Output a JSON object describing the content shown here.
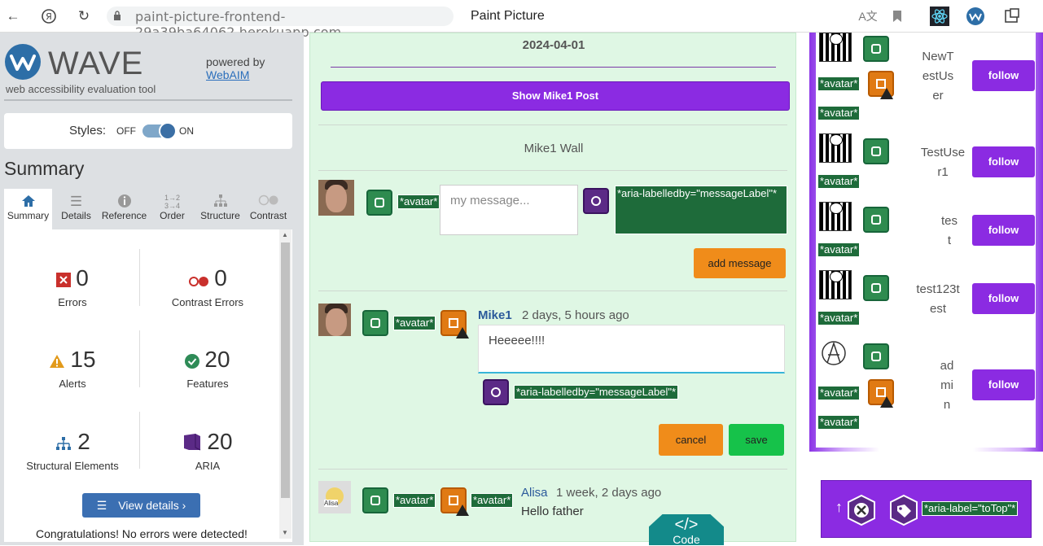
{
  "browser": {
    "url": "paint-picture-frontend-29a39ba64062.herokuapp.com",
    "tab_title": "Paint Picture"
  },
  "wave": {
    "logo_text": "WAVE",
    "logo_letter": "W",
    "subtitle": "web accessibility evaluation tool",
    "powered_by": "powered by",
    "webaim": "WebAIM",
    "styles_label": "Styles:",
    "styles_off": "OFF",
    "styles_on": "ON",
    "summary_heading": "Summary",
    "tabs": [
      {
        "label": "Summary",
        "icon": "home-icon"
      },
      {
        "label": "Details",
        "icon": "list-icon"
      },
      {
        "label": "Reference",
        "icon": "info-icon"
      },
      {
        "label": "Order",
        "icon": "order-icon"
      },
      {
        "label": "Structure",
        "icon": "structure-icon"
      },
      {
        "label": "Contrast",
        "icon": "contrast-icon"
      }
    ],
    "stats": {
      "errors": {
        "value": "0",
        "label": "Errors"
      },
      "contrast": {
        "value": "0",
        "label": "Contrast Errors"
      },
      "alerts": {
        "value": "15",
        "label": "Alerts"
      },
      "features": {
        "value": "20",
        "label": "Features"
      },
      "structural": {
        "value": "2",
        "label": "Structural Elements"
      },
      "aria": {
        "value": "20",
        "label": "ARIA"
      }
    },
    "view_details": "View details ›",
    "congrats": "Congratulations! No errors were detected!"
  },
  "page": {
    "date": "2024-04-01",
    "show_post_button": "Show Mike1 Post",
    "wall_title": "Mike1 Wall",
    "avatar_tag": "*avatar*",
    "message_placeholder": "my message...",
    "aria_labelledby_tag": "*aria-labelledby=\"messageLabel\"*",
    "add_message_button": "add message",
    "post": {
      "author": "Mike1",
      "time": "2 days, 5 hours ago",
      "text": "Heeeee!!!!"
    },
    "cancel_button": "cancel",
    "save_button": "save",
    "post2": {
      "author": "Alisa",
      "time": "1 week, 2 days ago",
      "text": "Hello father",
      "avatar_caption": "Alisa"
    },
    "code_tab_glyph": "</>",
    "code_tab_label": "Code"
  },
  "users": {
    "follow_label": "follow",
    "list": [
      {
        "name_lines": [
          "NewT",
          "estUs",
          "er"
        ]
      },
      {
        "name_lines": [
          "TestUse",
          "r1"
        ]
      },
      {
        "name_lines": [
          "tes",
          "t"
        ]
      },
      {
        "name_lines": [
          "test123t",
          "est"
        ]
      },
      {
        "name_lines": [
          "ad",
          "mi",
          "n"
        ]
      }
    ]
  },
  "totop": {
    "arrow": "↑",
    "aria_label_tag": "*aria-label=\"toTop\"*"
  },
  "colors": {
    "wave_blue": "#2d6ea7",
    "purple": "#8b2be2",
    "orange": "#f08c1a",
    "green": "#16c24a",
    "wave_label_green": "#1e6b3a"
  }
}
